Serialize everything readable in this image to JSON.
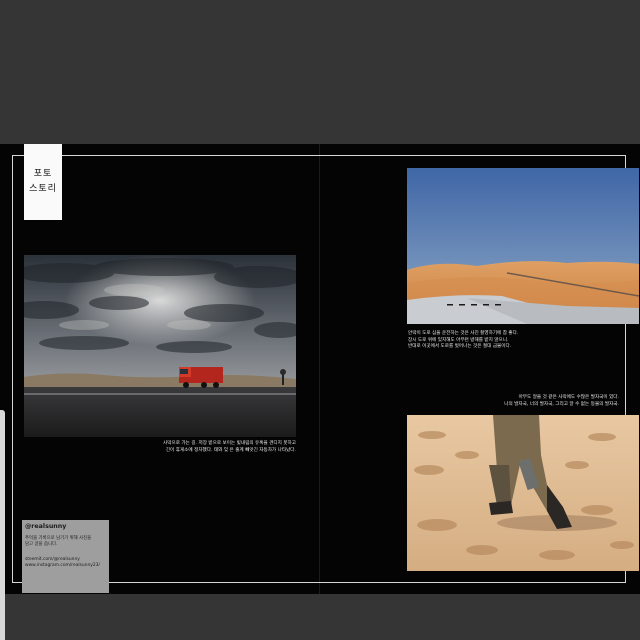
{
  "tab": {
    "line1": "포토",
    "line2": "스토리"
  },
  "left_caption": [
    "사막으로 가는 길. 저장 받으로 보이는 빛내림의 유혹을 견디지 못하고",
    "긴이 휴게소에 정차했다. 태와 잊 은 출계 빼앗긴 자동차가 나타났다."
  ],
  "right_top_caption": [
    "안락이 도로 심을 운전하는 것은 사진 촬영하기에 참 좋다.",
    "장시 도로 위에 있지해도 아무런 방해를 받지 않으니.",
    "반대로 이곳에서 도로를 벗어나는 것은 절대 금물이다."
  ],
  "right_bottom_caption": [
    "아무도 알을 것 같은 사막에도 수많은 발자국이 있다.",
    "나의 발자국, 너의 발자국, 그리고 알 수 없는 동물의 발자국."
  ],
  "info": {
    "handle": "@realsunny",
    "text1": "추억을 기록으로 남기기 위해 사진을",
    "text2": "담고 글을 씁니다.",
    "link1": "steemit.com/@realsunny",
    "link2": "www.instagram.com/realsunny23/"
  }
}
